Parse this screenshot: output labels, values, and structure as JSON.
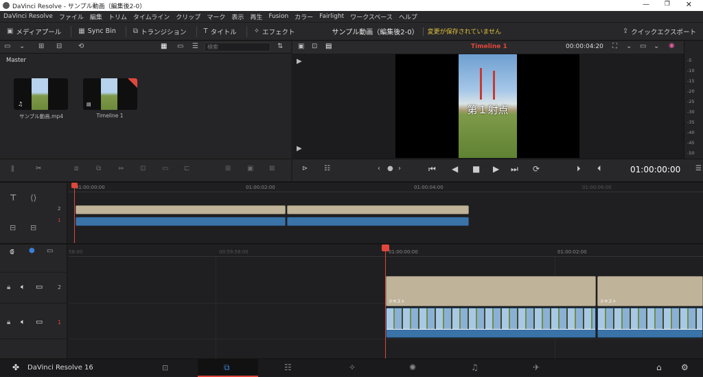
{
  "app_title": "DaVinci Resolve - サンプル動画（編集後2-0）",
  "menu": [
    "DaVinci Resolve",
    "ファイル",
    "編集",
    "トリム",
    "タイムライン",
    "クリップ",
    "マーク",
    "表示",
    "再生",
    "Fusion",
    "カラー",
    "Fairlight",
    "ワークスペース",
    "ヘルプ"
  ],
  "toolbar": {
    "media_pool": "メディアプール",
    "sync_bin": "Sync Bin",
    "transitions": "トランジション",
    "titles": "タイトル",
    "effects": "エフェクト",
    "project_name": "サンプル動画（編集後2-0）",
    "unsaved": "変更が保存されていません",
    "quick_export": "クイックエクスポート"
  },
  "media_pool": {
    "search_placeholder": "検索",
    "bin_name": "Master",
    "clips": [
      {
        "name": "サンプル動画.mp4"
      },
      {
        "name": "Timeline 1"
      }
    ]
  },
  "viewer": {
    "timeline_name": "Timeline 1",
    "duration": "00:00:04:20",
    "overlay_text": "第１射点",
    "timecode": "01:00:00:00"
  },
  "meter_ticks": [
    "-5",
    "-10",
    "-15",
    "-20",
    "-25",
    "-30",
    "-35",
    "-40",
    "-45",
    "-50"
  ],
  "upper_ruler": [
    "01:00:00:00",
    "01:00:02:00",
    "01:00:04:00",
    "01:00:06:00"
  ],
  "upper_tracks": [
    "2",
    "1"
  ],
  "lower_ruler": [
    "00:59:58:00",
    "01:00:00:00",
    "01:00:02:00"
  ],
  "lower_ruler_start": "58:00",
  "lower_tracks": [
    "2",
    "1"
  ],
  "text_clip_label": "テキスト",
  "pagebar": {
    "brand": "DaVinci Resolve 16"
  },
  "colors": {
    "accent": "#e0473c",
    "video_clip": "#3a73a8",
    "text_clip": "#bfb39a",
    "unsaved": "#e0c23c"
  }
}
